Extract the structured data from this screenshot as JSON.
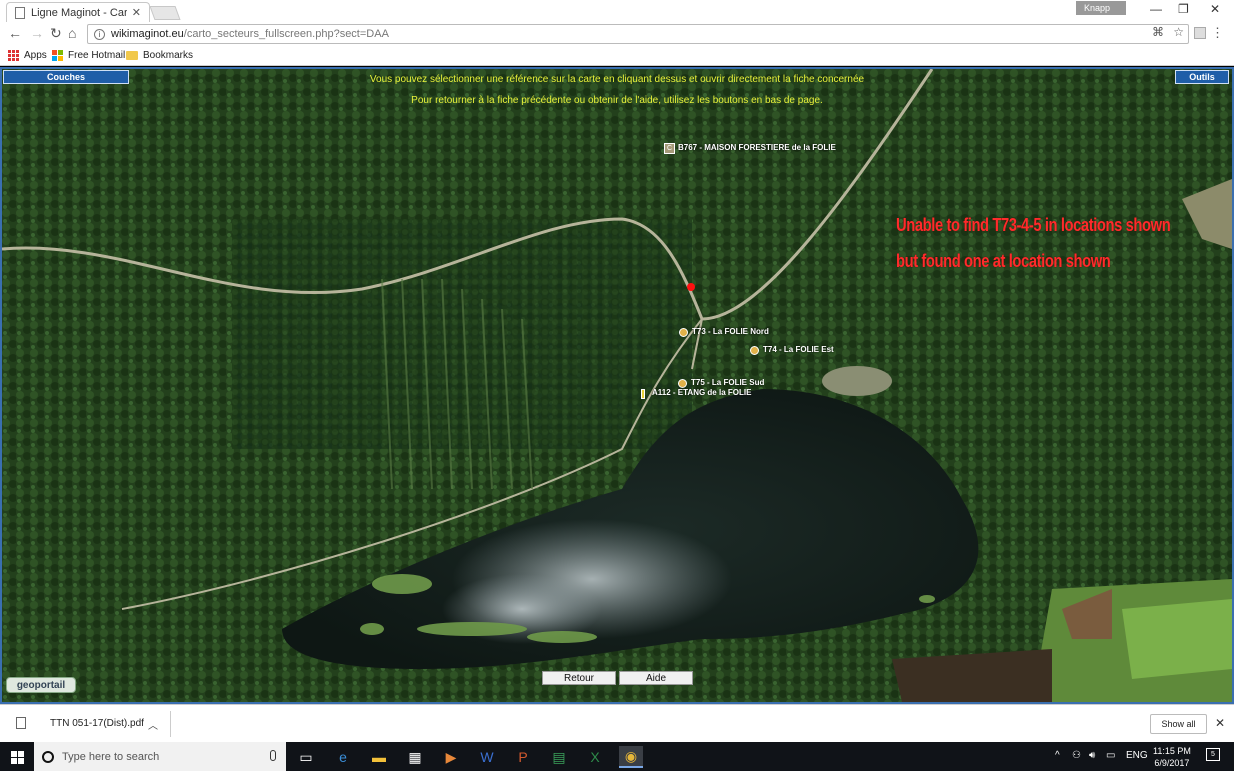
{
  "browser": {
    "tab_title": "Ligne Maginot - Cartogr",
    "tab_close": "✕",
    "profile_name": "Knapp",
    "url_domain": "wikimaginot.eu",
    "url_path": "/carto_secteurs_fullscreen.php?sect=DAA",
    "bookmarks": [
      {
        "label": "Apps"
      },
      {
        "label": "Free Hotmail"
      },
      {
        "label": "Bookmarks"
      }
    ]
  },
  "map": {
    "couches_label": "Couches",
    "outils_label": "Outils",
    "notice_line1": "Vous pouvez sélectionner une référence sur la carte en cliquant dessus et ouvrir directement la fiche concernée",
    "notice_line2": "Pour retourner à la fiche précédente ou obtenir de l'aide, utilisez les boutons en bas de page.",
    "points": {
      "b767": "B767 - MAISON FORESTIERE de la FOLIE",
      "b767_icon": "C",
      "t73": "T73 - La FOLIE Nord",
      "t74": "T74 - La FOLIE Est",
      "t75": "T75 - La FOLIE Sud",
      "a112": "A112 - ETANG de la FOLIE"
    },
    "annotation_line1": "Unable to find T73-4-5 in locations shown",
    "annotation_line2": "but found one at location shown",
    "geoportail": "geoportail",
    "retour_label": "Retour",
    "aide_label": "Aide"
  },
  "download_bar": {
    "file_name": "TTN 051-17(Dist).pdf",
    "show_all_label": "Show all"
  },
  "taskbar": {
    "search_placeholder": "Type here to search",
    "language": "ENG",
    "time": "11:15 PM",
    "date": "6/9/2017",
    "notification_count": "5"
  },
  "colors": {
    "notice": "#e8f23a",
    "annotation": "#ff2b2b",
    "map_button": "#1f5ea8",
    "red_marker": "#ff1010"
  }
}
